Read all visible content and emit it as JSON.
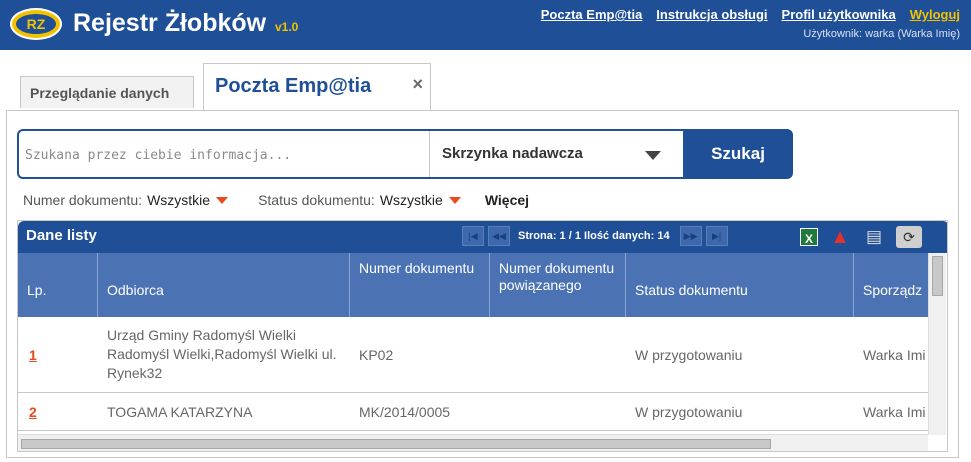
{
  "header": {
    "logo_text": "RZ",
    "title": "Rejestr Żłobków",
    "version": "v1.0",
    "nav": [
      {
        "label": "Poczta Emp@tia"
      },
      {
        "label": "Instrukcja obsługi"
      },
      {
        "label": "Profil użytkownika"
      },
      {
        "label": "Wyloguj"
      }
    ],
    "user_line": "Użytkownik: warka (Warka Imię)"
  },
  "tabs": [
    {
      "label": "Przeglądanie danych"
    },
    {
      "label": "Poczta Emp@tia",
      "close": "×"
    }
  ],
  "search": {
    "value": "",
    "placeholder": "Szukana przez ciebie informacja...",
    "mailbox": "Skrzynka nadawcza",
    "button": "Szukaj"
  },
  "filters": {
    "doc_number_label": "Numer dokumentu:",
    "doc_number_value": "Wszystkie",
    "status_label": "Status dokumentu:",
    "status_value": "Wszystkie",
    "more": "Więcej"
  },
  "grid": {
    "title": "Dane listy",
    "pager_info": "Strona: 1 / 1 Ilość danych: 14",
    "pager_icons": [
      "first-page-icon",
      "prev-page-icon",
      "next-page-icon",
      "last-page-icon"
    ],
    "tools": {
      "xls": "X",
      "pdf_icon": "pdf-icon",
      "report_icon": "report-icon",
      "refresh": "⟳"
    },
    "columns": [
      "Lp.",
      "Odbiorca",
      "Numer dokumentu",
      "Numer dokumentu powiązanego",
      "Status dokumentu",
      "Sporządz"
    ],
    "rows": [
      {
        "lp": "1",
        "recipient": "Urząd Gminy Radomyśl Wielki Radomyśl Wielki,Radomyśl Wielki ul. Rynek32",
        "doc_number": "KP02",
        "related": "",
        "status": "W przygotowaniu",
        "author": "Warka Imi"
      },
      {
        "lp": "2",
        "recipient": "TOGAMA KATARZYNA",
        "doc_number": "MK/2014/0005",
        "related": "",
        "status": "W przygotowaniu",
        "author": "Warka Imi"
      }
    ]
  },
  "colors": {
    "primary": "#1e4f97",
    "header_row": "#4b73b4",
    "accent": "#f2c200",
    "link": "#e84a1d"
  }
}
